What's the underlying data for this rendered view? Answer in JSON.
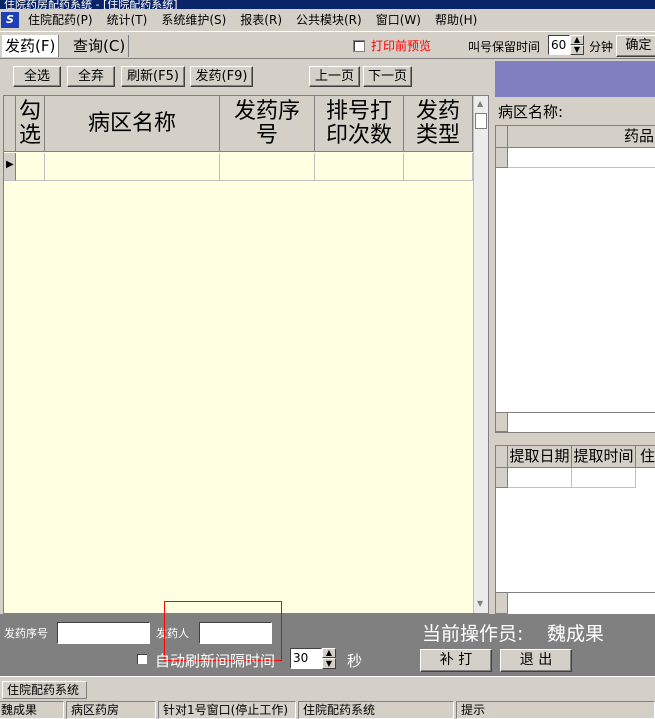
{
  "window": {
    "title": "住院药房配药系统 - [住院配药系统]"
  },
  "menu": {
    "logo": "S",
    "items": [
      "住院配药(P)",
      "统计(T)",
      "系统维护(S)",
      "报表(R)",
      "公共模块(R)",
      "窗口(W)",
      "帮助(H)"
    ]
  },
  "tabs": {
    "dispense": "发药(F)",
    "query": "查询(C)"
  },
  "toolbar": {
    "print_preview_label": "打印前预览",
    "print_preview_checked": false,
    "retain_time_label": "叫号保留时间",
    "retain_time_value": "60",
    "minutes_label": "分钟",
    "confirm_label": "确定"
  },
  "actions": {
    "select_all": "全选",
    "discard_all": "全弃",
    "refresh": "刷新(F5)",
    "dispense": "发药(F9)",
    "prev_page": "上一页",
    "next_page": "下一页"
  },
  "main_grid": {
    "columns": [
      "勾选",
      "病区名称",
      "发药序号",
      "排号打印次数",
      "发药类型"
    ],
    "rows": [
      [
        "",
        "",
        "",
        "",
        ""
      ]
    ]
  },
  "right_panel": {
    "ward_label": "病区名称:",
    "drug_grid": {
      "columns": [
        "药品"
      ]
    },
    "pick_grid": {
      "columns": [
        "提取日期",
        "提取时间",
        "住"
      ]
    }
  },
  "bottom": {
    "seq_label": "发药序号",
    "seq_value": "",
    "person_label": "发药人",
    "person_value": "",
    "auto_refresh_label": "自动刷新间隔时间",
    "auto_refresh_checked": false,
    "interval_value": "30",
    "seconds_label": "秒",
    "operator_label": "当前操作员:",
    "operator_name": "魏成果",
    "reprint_label": "补  打",
    "exit_label": "退  出"
  },
  "taskbar": {
    "active_window": "住院配药系统"
  },
  "statusbar": {
    "panes": [
      "魏成果",
      "病区药房",
      "针对1号窗口(停止工作)",
      "住院配药系统",
      "提示"
    ]
  },
  "colors": {
    "grid_bg": "#ffffe1",
    "title_bar": "#0a246a",
    "panel_header": "#8080c0",
    "alert_text": "#ff0000"
  }
}
